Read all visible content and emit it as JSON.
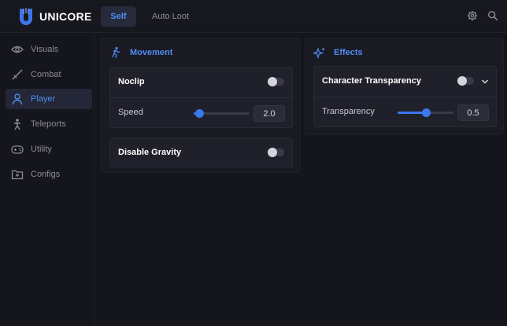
{
  "header": {
    "brand": "UNICORE",
    "tabs": [
      {
        "label": "Self",
        "active": true
      },
      {
        "label": "Auto Loot",
        "active": false
      }
    ],
    "accent_color": "#4f8cf5"
  },
  "sidebar": {
    "items": [
      {
        "label": "Visuals",
        "icon": "eye-icon",
        "active": false
      },
      {
        "label": "Combat",
        "icon": "sword-icon",
        "active": false
      },
      {
        "label": "Player",
        "icon": "user-icon",
        "active": true
      },
      {
        "label": "Teleports",
        "icon": "teleport-icon",
        "active": false
      },
      {
        "label": "Utility",
        "icon": "gamepad-icon",
        "active": false
      },
      {
        "label": "Configs",
        "icon": "folder-icon",
        "active": false
      }
    ]
  },
  "movement": {
    "title": "Movement",
    "noclip": {
      "label": "Noclip",
      "enabled": false
    },
    "speed": {
      "label": "Speed",
      "value": "2.0",
      "fraction": 0.1
    },
    "disable_gravity": {
      "label": "Disable Gravity",
      "enabled": false
    }
  },
  "effects": {
    "title": "Effects",
    "character_transparency": {
      "label": "Character Transparency",
      "enabled": false
    },
    "transparency": {
      "label": "Transparency",
      "value": "0.5",
      "fraction": 0.5
    }
  }
}
